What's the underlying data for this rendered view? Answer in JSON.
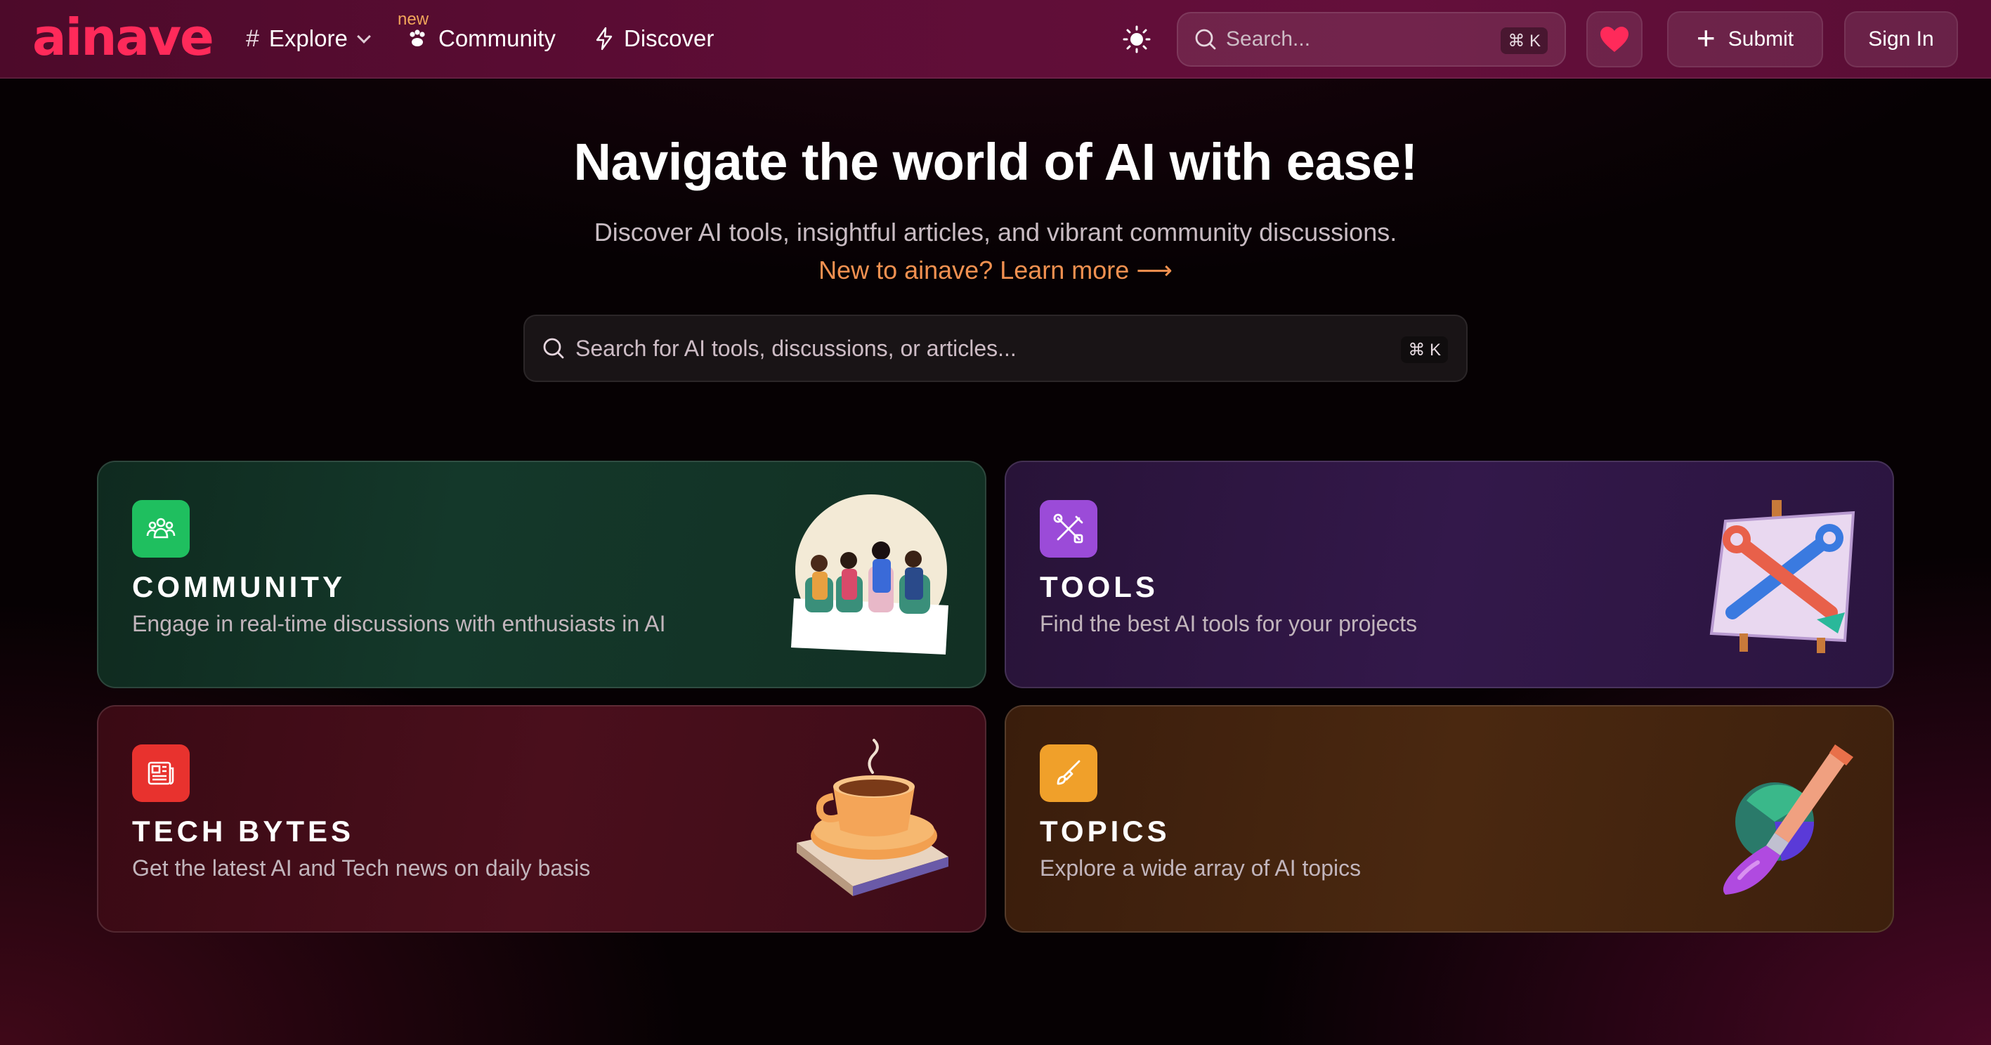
{
  "header": {
    "logo_text": "ainave",
    "nav": {
      "explore_label": "Explore",
      "community_label": "Community",
      "community_badge": "new",
      "discover_label": "Discover"
    },
    "search": {
      "placeholder": "Search...",
      "shortcut": "⌘ K"
    },
    "submit_label": "Submit",
    "signin_label": "Sign In"
  },
  "hero": {
    "title": "Navigate the world of AI with ease!",
    "subtitle": "Discover AI tools, insightful articles, and vibrant community discussions.",
    "link_text": "New to ainave? Learn more ⟶",
    "search_placeholder": "Search for AI tools, discussions, or articles...",
    "search_shortcut": "⌘ K"
  },
  "cards": [
    {
      "title": "COMMUNITY",
      "description": "Engage in real-time discussions with enthusiasts in AI",
      "icon": "community-icon",
      "accent": "#1fbf5f"
    },
    {
      "title": "TOOLS",
      "description": "Find the best AI tools for your projects",
      "icon": "tools-icon",
      "accent": "#9b4bd8"
    },
    {
      "title": "TECH BYTES",
      "description": "Get the latest AI and Tech news on daily basis",
      "icon": "newspaper-icon",
      "accent": "#e8322e"
    },
    {
      "title": "TOPICS",
      "description": "Explore a wide array of AI topics",
      "icon": "brush-icon",
      "accent": "#f0a02a"
    }
  ],
  "colors": {
    "brand": "#ff2a5a",
    "link": "#f09050",
    "header_bg": "#5e0d36"
  }
}
